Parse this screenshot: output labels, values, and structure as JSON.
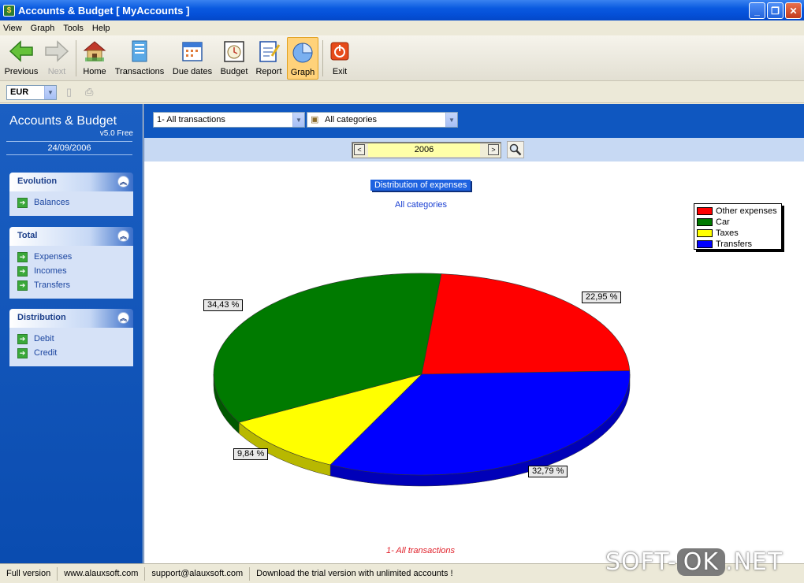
{
  "window": {
    "title": "Accounts & Budget [ MyAccounts ]",
    "controls": {
      "minimize": "_",
      "maximize": "❐",
      "close": "✕"
    }
  },
  "menu": [
    "View",
    "Graph",
    "Tools",
    "Help"
  ],
  "toolbar": {
    "items": [
      {
        "label": "Previous",
        "icon": "back-arrow-icon",
        "state": "enabled"
      },
      {
        "label": "Next",
        "icon": "forward-arrow-icon",
        "state": "disabled"
      },
      {
        "label": "Home",
        "icon": "home-icon",
        "state": "enabled"
      },
      {
        "label": "Transactions",
        "icon": "transactions-icon",
        "state": "enabled"
      },
      {
        "label": "Due dates",
        "icon": "calendar-icon",
        "state": "enabled"
      },
      {
        "label": "Budget",
        "icon": "budget-clock-icon",
        "state": "enabled"
      },
      {
        "label": "Report",
        "icon": "report-icon",
        "state": "enabled"
      },
      {
        "label": "Graph",
        "icon": "pie-chart-icon",
        "state": "active"
      },
      {
        "label": "Exit",
        "icon": "power-icon",
        "state": "enabled"
      }
    ]
  },
  "currency": {
    "value": "EUR"
  },
  "sidebar": {
    "brand": "Accounts & Budget",
    "version": "v5.0 Free",
    "date": "24/09/2006",
    "panels": [
      {
        "title": "Evolution",
        "items": [
          "Balances"
        ]
      },
      {
        "title": "Total",
        "items": [
          "Expenses",
          "Incomes",
          "Transfers"
        ]
      },
      {
        "title": "Distribution",
        "items": [
          "Debit",
          "Credit"
        ]
      }
    ]
  },
  "filters": {
    "transactions": "1- All transactions",
    "categories": "All categories"
  },
  "year": {
    "value": "2006",
    "prev": "<",
    "next": ">"
  },
  "chart_data": {
    "type": "pie",
    "title": "Distribution of expenses",
    "subtitle": "All categories",
    "footer": "1- All transactions",
    "legend_position": "top-right",
    "slices": [
      {
        "name": "Other expenses",
        "value": 22.95,
        "label": "22,95 %",
        "color": "#ff0000"
      },
      {
        "name": "Car",
        "value": 34.43,
        "label": "34,43 %",
        "color": "#007a00"
      },
      {
        "name": "Taxes",
        "value": 9.84,
        "label": "9,84 %",
        "color": "#ffff00"
      },
      {
        "name": "Transfers",
        "value": 32.79,
        "label": "32,79 %",
        "color": "#0000ff"
      }
    ]
  },
  "status": {
    "cells": [
      "Full version",
      "www.alauxsoft.com",
      "support@alauxsoft.com",
      "Download the trial version with unlimited accounts !"
    ]
  },
  "watermark": {
    "prefix": "SOFT-",
    "ok": "OK",
    "suffix": ".NET"
  }
}
